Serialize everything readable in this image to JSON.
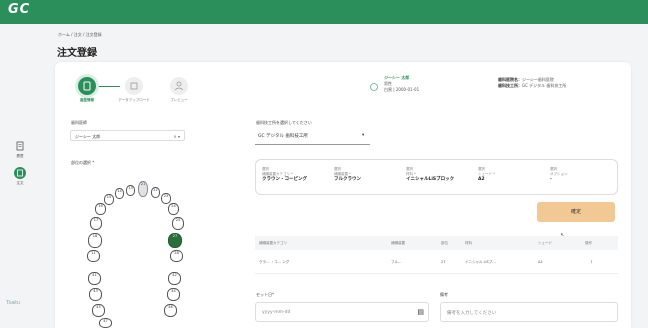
{
  "app": {
    "logo": "GC",
    "brand": "Tsaku",
    "colors": {
      "primary": "#2a8f5a",
      "accent": "#f2c894"
    }
  },
  "sidebar": {
    "items": [
      {
        "label": "履歴",
        "icon": "list-icon"
      },
      {
        "label": "注文",
        "icon": "order-icon"
      }
    ]
  },
  "breadcrumb": "ホーム / 注文 / 注文登録",
  "page_title": "注文登録",
  "steps": [
    {
      "label": "歯型情報",
      "icon": "tooth-icon"
    },
    {
      "label": "データアップロード",
      "icon": "upload-icon"
    },
    {
      "label": "プレビュー",
      "icon": "preview-icon"
    }
  ],
  "patient": {
    "name": "ジーシー 太郎",
    "sex": "男性",
    "birth": "白黒 | 2000-01-01"
  },
  "clinic": {
    "label1": "歯科医院名：",
    "value1": "ジーシー歯科医院",
    "label2": "歯科技工所：",
    "value2": "GC デジタル 歯科技工所"
  },
  "dentist": {
    "label": "歯科医師",
    "value": "ジーシー 太郎"
  },
  "lab": {
    "label": "歯科技工所を選択してください",
    "value": "GC デジタル 歯科技工所"
  },
  "tooth_label": "部位の選択 *",
  "selection": [
    {
      "caption": "選択\n補綴装置カテゴリ *",
      "value": "クラウン・コーピング"
    },
    {
      "caption": "選択\n補綴装置 *",
      "value": "フルクラウン"
    },
    {
      "caption": "選択\n材料 *",
      "value": "イニシャルLiSブロック"
    },
    {
      "caption": "選択\nシェード *",
      "value": "A2"
    },
    {
      "caption": "選択\nオプション",
      "value": "-"
    }
  ],
  "confirm_label": "確定",
  "table": {
    "headers": [
      "補綴装置カテゴリ",
      "補綴装置",
      "部位",
      "材料",
      "シェード",
      "操作"
    ],
    "row": [
      "クラ… ・コ… ング",
      "フル…",
      "27",
      "イニシャル LiSブ…",
      "A2",
      "⋮"
    ]
  },
  "set_date": {
    "label": "セット日*",
    "placeholder": "yyyy-mm-dd"
  },
  "note": {
    "label": "備考",
    "placeholder": "備考を入力してください"
  },
  "teeth_upper": [
    "11",
    "12",
    "13",
    "14",
    "15",
    "16",
    "17",
    "18",
    "21",
    "22",
    "23",
    "24",
    "25",
    "26",
    "27",
    "28"
  ],
  "teeth_lower": [
    "41",
    "42",
    "43",
    "44",
    "45",
    "46",
    "47"
  ]
}
